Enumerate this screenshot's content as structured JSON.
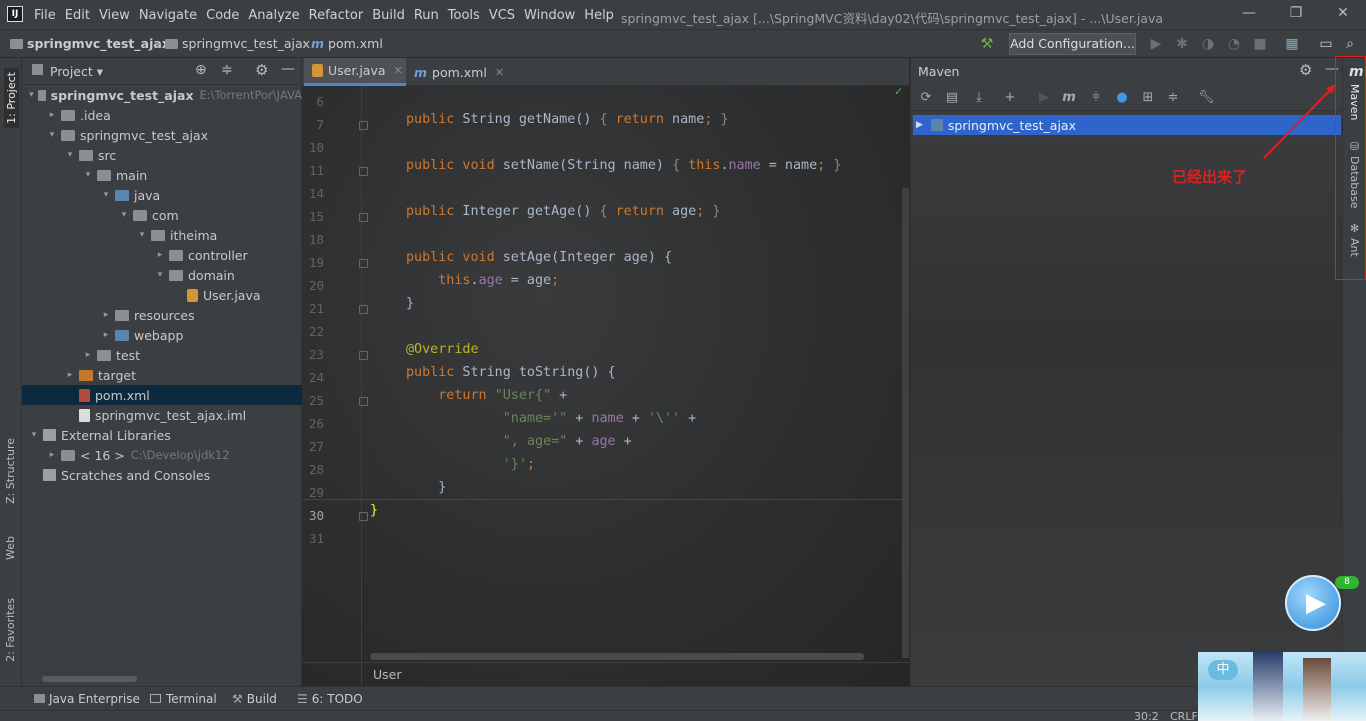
{
  "menubar": {
    "logo": "IJ",
    "items": [
      "File",
      "Edit",
      "View",
      "Navigate",
      "Code",
      "Analyze",
      "Refactor",
      "Build",
      "Run",
      "Tools",
      "VCS",
      "Window",
      "Help"
    ],
    "title": "springmvc_test_ajax [...\\SpringMVC资料\\day02\\代码\\springmvc_test_ajax] - ...\\User.java"
  },
  "navbar": {
    "crumbs": [
      "springmvc_test_ajax",
      "springmvc_test_ajax",
      "pom.xml"
    ],
    "add_config": "Add Configuration..."
  },
  "left_strip": {
    "project": "1: Project",
    "structure": "Z: Structure",
    "web": "Web",
    "favorites": "2: Favorites"
  },
  "right_strip": {
    "maven": "Maven",
    "database": "Database",
    "ant": "Ant"
  },
  "project": {
    "header": "Project",
    "tree": [
      {
        "label": "springmvc_test_ajax",
        "extra": "E:\\TorrentPor\\JAVA",
        "depth": 0,
        "arrow": "▾",
        "icon": "folder",
        "bold": true
      },
      {
        "label": ".idea",
        "depth": 1,
        "arrow": "▸",
        "icon": "folder"
      },
      {
        "label": "springmvc_test_ajax",
        "depth": 1,
        "arrow": "▾",
        "icon": "folder"
      },
      {
        "label": "src",
        "depth": 2,
        "arrow": "▾",
        "icon": "folder"
      },
      {
        "label": "main",
        "depth": 3,
        "arrow": "▾",
        "icon": "folder"
      },
      {
        "label": "java",
        "depth": 4,
        "arrow": "▾",
        "icon": "blue"
      },
      {
        "label": "com",
        "depth": 5,
        "arrow": "▾",
        "icon": "folder"
      },
      {
        "label": "itheima",
        "depth": 6,
        "arrow": "▾",
        "icon": "folder"
      },
      {
        "label": "controller",
        "depth": 7,
        "arrow": "▸",
        "icon": "folder"
      },
      {
        "label": "domain",
        "depth": 7,
        "arrow": "▾",
        "icon": "folder"
      },
      {
        "label": "User.java",
        "depth": 8,
        "arrow": "",
        "icon": "java"
      },
      {
        "label": "resources",
        "depth": 4,
        "arrow": "▸",
        "icon": "folder"
      },
      {
        "label": "webapp",
        "depth": 4,
        "arrow": "▸",
        "icon": "blue"
      },
      {
        "label": "test",
        "depth": 3,
        "arrow": "▸",
        "icon": "folder"
      },
      {
        "label": "target",
        "depth": 2,
        "arrow": "▸",
        "icon": "orange"
      },
      {
        "label": "pom.xml",
        "depth": 2,
        "arrow": "",
        "icon": "xml",
        "selected": true
      },
      {
        "label": "springmvc_test_ajax.iml",
        "depth": 2,
        "arrow": "",
        "icon": "file"
      },
      {
        "label": "External Libraries",
        "depth": 0,
        "arrow": "▾",
        "icon": "lib"
      },
      {
        "label": "< 16 >",
        "extra": "C:\\Develop\\jdk12",
        "depth": 1,
        "arrow": "▸",
        "icon": "folder"
      },
      {
        "label": "Scratches and Consoles",
        "depth": 0,
        "arrow": "",
        "icon": "lib"
      }
    ]
  },
  "editor": {
    "tabs": [
      {
        "label": "User.java",
        "active": true
      },
      {
        "label": "pom.xml",
        "active": false
      }
    ],
    "line_numbers": [
      "6",
      "7",
      "10",
      "11",
      "14",
      "15",
      "18",
      "19",
      "20",
      "21",
      "22",
      "23",
      "24",
      "25",
      "26",
      "27",
      "28",
      "29",
      "30",
      "31"
    ],
    "breadcrumb": "User"
  },
  "maven": {
    "header": "Maven",
    "project": "springmvc_test_ajax"
  },
  "bottombar": {
    "java_ee": "Java Enterprise",
    "terminal": "Terminal",
    "build": "Build",
    "todo": "6: TODO"
  },
  "status": {
    "position": "30:2",
    "line_sep": "CRLF"
  },
  "annotation": {
    "text": "已经出来了",
    "color": "#e02020"
  },
  "widget": {
    "badge": "8"
  }
}
